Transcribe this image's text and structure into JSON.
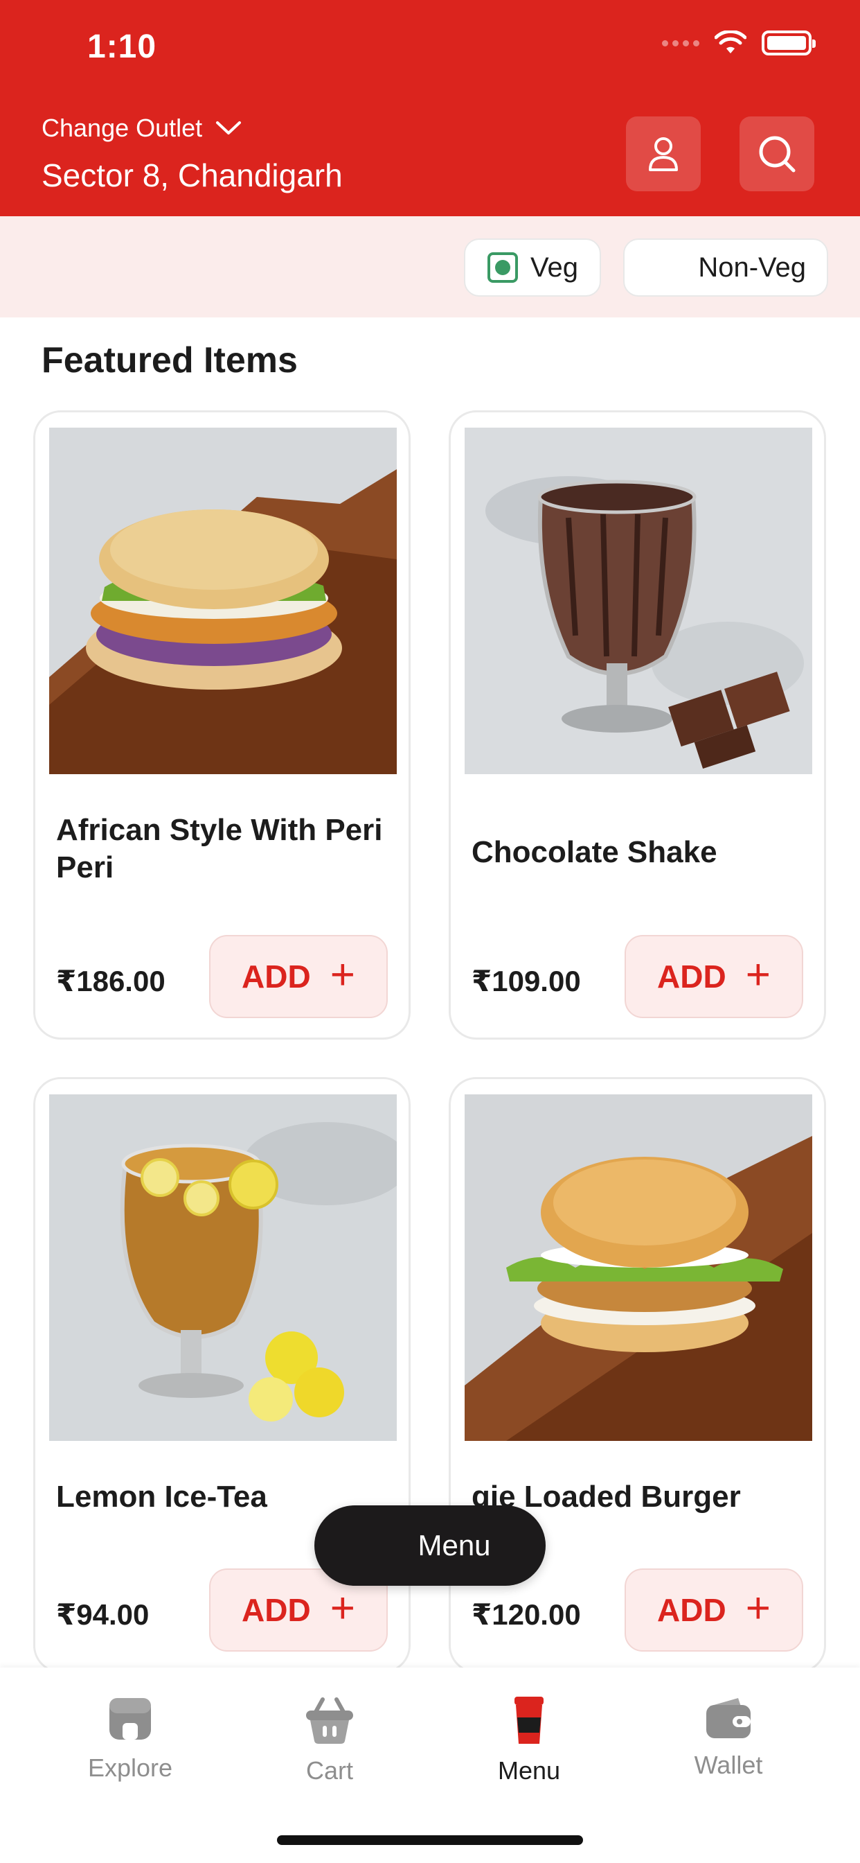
{
  "status_bar": {
    "time": "1:10"
  },
  "header": {
    "change_outlet_label": "Change Outlet",
    "outlet_name": "Sector 8, Chandigarh"
  },
  "filters": {
    "veg_label": "Veg",
    "nonveg_label": "Non-Veg"
  },
  "section_title": "Featured Items",
  "items": [
    {
      "name": "African Style With Peri Peri",
      "price": "₹186.00",
      "add_label": "ADD",
      "veg": false,
      "image": "chicken-burger"
    },
    {
      "name": "Chocolate Shake",
      "price": "₹109.00",
      "add_label": "ADD",
      "veg": true,
      "image": "chocolate-shake"
    },
    {
      "name": "Lemon Ice-Tea",
      "price": "₹94.00",
      "add_label": "ADD",
      "veg": false,
      "image": "lemon-ice-tea"
    },
    {
      "name": "gie Loaded Burger",
      "price": "₹120.00",
      "add_label": "ADD",
      "veg": false,
      "image": "veggie-burger"
    }
  ],
  "menu_pill_label": "Menu",
  "bottom_nav": [
    {
      "label": "Explore",
      "icon": "store-icon",
      "active": false
    },
    {
      "label": "Cart",
      "icon": "basket-icon",
      "active": false
    },
    {
      "label": "Menu",
      "icon": "cup-icon",
      "active": true
    },
    {
      "label": "Wallet",
      "icon": "wallet-icon",
      "active": false
    }
  ],
  "colors": {
    "brand_red": "#db241e",
    "veg_green": "#3a9a64",
    "filter_bg": "#fbeceb",
    "add_bg": "#fdeceb"
  }
}
